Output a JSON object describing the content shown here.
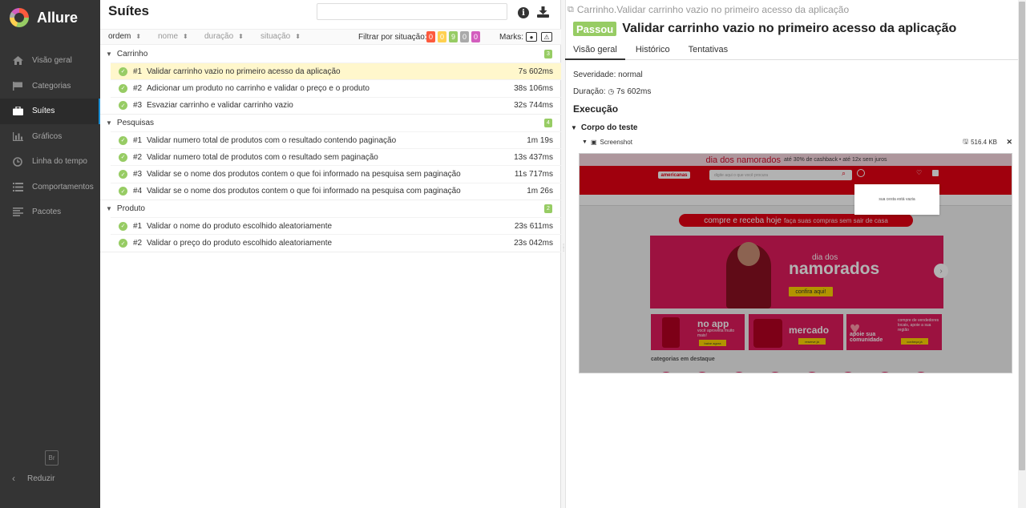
{
  "sidebar": {
    "brand": "Allure",
    "items": [
      {
        "label": "Visão geral",
        "icon": "home-icon"
      },
      {
        "label": "Categorias",
        "icon": "flag-icon"
      },
      {
        "label": "Suítes",
        "icon": "briefcase-icon"
      },
      {
        "label": "Gráficos",
        "icon": "bar-chart-icon"
      },
      {
        "label": "Linha do tempo",
        "icon": "clock-icon"
      },
      {
        "label": "Comportamentos",
        "icon": "list-icon"
      },
      {
        "label": "Pacotes",
        "icon": "align-left-icon"
      }
    ],
    "active_index": 2,
    "language": "Br",
    "collapse_label": "Reduzir"
  },
  "left": {
    "title": "Suítes",
    "search_value": "",
    "sort": {
      "order": "ordem",
      "name": "nome",
      "duration": "duração",
      "status": "situação"
    },
    "filter_label": "Filtrar por situação:",
    "status_counts": [
      {
        "value": "0",
        "color": "#fd5a3e"
      },
      {
        "value": "0",
        "color": "#ffd050"
      },
      {
        "value": "9",
        "color": "#97cc64"
      },
      {
        "value": "0",
        "color": "#aaaaaa"
      },
      {
        "value": "0",
        "color": "#d35ebe"
      }
    ],
    "marks_label": "Marks:",
    "groups": [
      {
        "name": "Carrinho",
        "count": "3",
        "tests": [
          {
            "num": "#1",
            "title": "Validar carrinho vazio no primeiro acesso da aplicação",
            "duration": "7s 602ms",
            "selected": true
          },
          {
            "num": "#2",
            "title": "Adicionar um produto no carrinho e validar o preço e o produto",
            "duration": "38s 106ms"
          },
          {
            "num": "#3",
            "title": "Esvaziar carrinho e validar carrinho vazio",
            "duration": "32s 744ms"
          }
        ]
      },
      {
        "name": "Pesquisas",
        "count": "4",
        "tests": [
          {
            "num": "#1",
            "title": "Validar numero total de produtos com o resultado contendo paginação",
            "duration": "1m 19s"
          },
          {
            "num": "#2",
            "title": "Validar numero total de produtos com o resultado sem paginação",
            "duration": "13s 437ms"
          },
          {
            "num": "#3",
            "title": "Validar se o nome dos produtos contem o que foi informado na pesquisa sem paginação",
            "duration": "11s 717ms"
          },
          {
            "num": "#4",
            "title": "Validar se o nome dos produtos contem o que foi informado na pesquisa com paginação",
            "duration": "1m 26s"
          }
        ]
      },
      {
        "name": "Produto",
        "count": "2",
        "tests": [
          {
            "num": "#1",
            "title": "Validar o nome do produto escolhido aleatoriamente",
            "duration": "23s 611ms"
          },
          {
            "num": "#2",
            "title": "Validar o preço do produto escolhido aleatoriamente",
            "duration": "23s 042ms"
          }
        ]
      }
    ]
  },
  "right": {
    "breadcrumb": "Carrinho.Validar carrinho vazio no primeiro acesso da aplicação",
    "status": "Passou",
    "status_color": "#97cc64",
    "title": "Validar carrinho vazio no primeiro acesso da aplicação",
    "tabs": [
      "Visão geral",
      "Histórico",
      "Tentativas"
    ],
    "severity": "Severidade: normal",
    "duration_label": "Duração:",
    "duration": "7s 602ms",
    "execution": "Execução",
    "body_title": "Corpo do teste",
    "attachment": {
      "name": "Screenshot",
      "size": "516.4 KB"
    },
    "screenshot": {
      "top_banner": "dia dos namorados",
      "top_banner_note": "até 30% de cashback • até 12x sem juros",
      "logo": "americanas",
      "search_placeholder": "digite aqui o que você procura",
      "cart_popup": "sua cesta está vazia",
      "promo_pill": "compre e receba hoje",
      "promo_pill_note": "faça suas compras sem sair de casa",
      "banner_small": "dia dos",
      "banner_big": "namorados",
      "banner_button": "confira aqui!",
      "tile_app": "no app",
      "tile_app_sub": "você aproveita muito mais!",
      "tile_app_btn": "baixe agora",
      "tile_market": "mercado",
      "tile_market_btn": "reserve já",
      "tile_community": "apoie sua comunidade",
      "tile_community_sub": "compre de vendedores locais, apoie a sua região",
      "tile_community_btn": "conheça já",
      "categories_title": "categorias em destaque"
    }
  }
}
